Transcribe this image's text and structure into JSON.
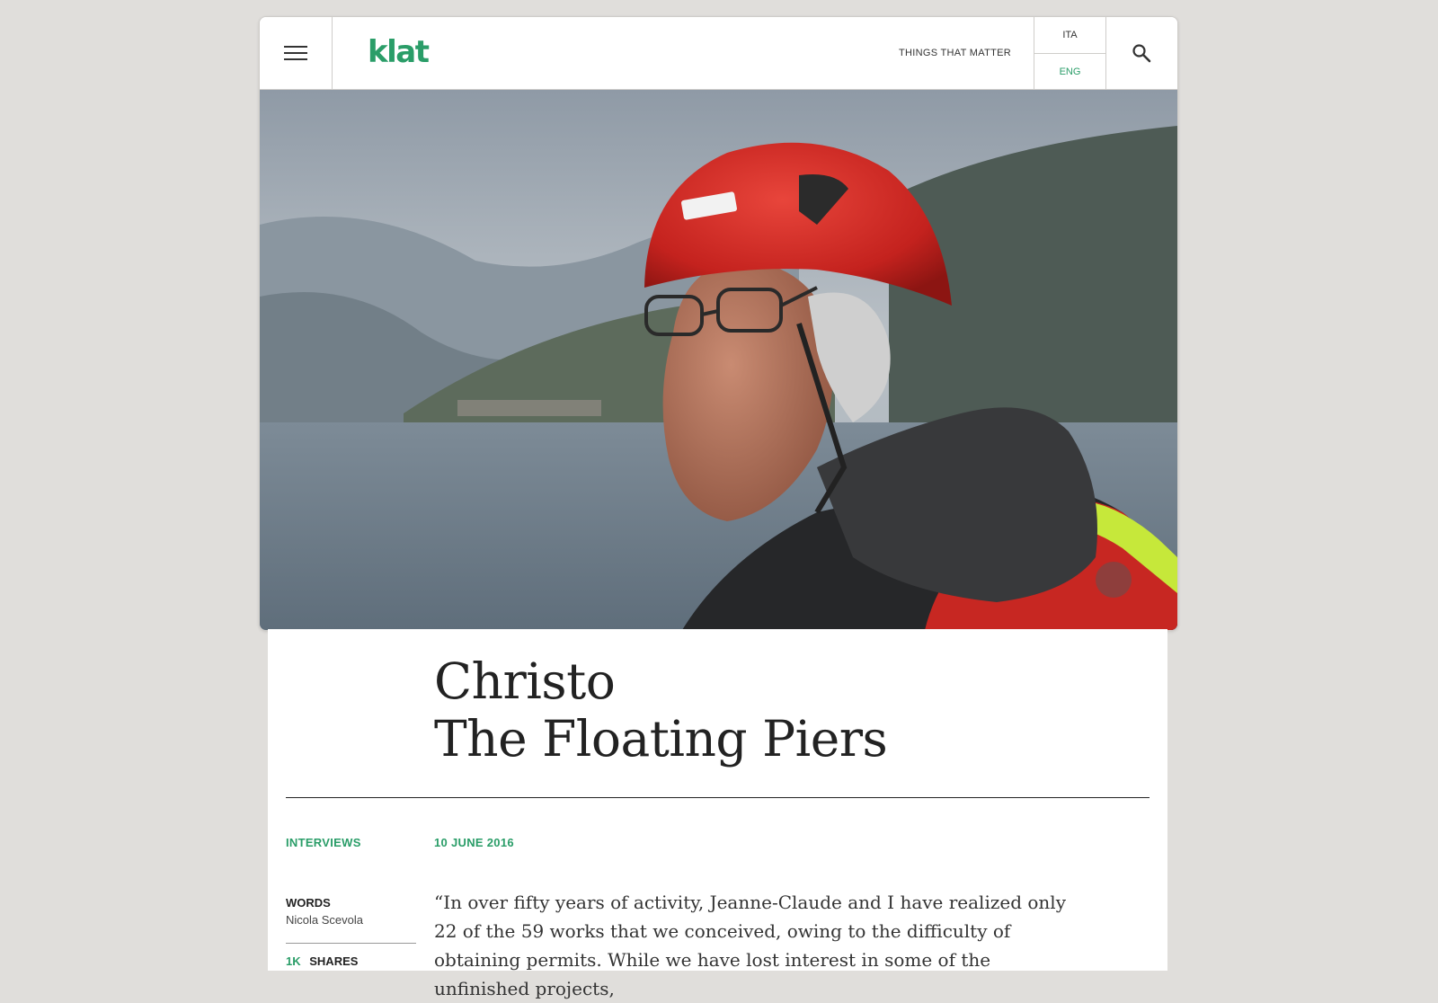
{
  "header": {
    "logo": "klat",
    "tagline": "THINGS THAT MATTER",
    "languages": [
      {
        "label": "ITA",
        "active": false
      },
      {
        "label": "ENG",
        "active": true
      }
    ],
    "menu_icon": "hamburger-menu-icon",
    "search_icon": "search-icon"
  },
  "hero": {
    "image": "photo of an elderly man wearing a red helmet and glasses in front of a lake and mountains"
  },
  "article": {
    "title_line1": "Christo",
    "title_line2": "The Floating Piers",
    "category": "INTERVIEWS",
    "date": "10 JUNE 2016",
    "words_label": "WORDS",
    "author": "Nicola Scevola",
    "shares_count": "1k",
    "shares_label": "SHARES",
    "lead": "“In over fifty years of activity, Jeanne-Claude and I have realized only 22 of the 59 works that we conceived, owing to the difficulty of obtaining permits. While we have lost interest in some of the unfinished projects,"
  },
  "colors": {
    "accent": "#2a9d68",
    "background": "#e0dedb",
    "text": "#222222"
  }
}
